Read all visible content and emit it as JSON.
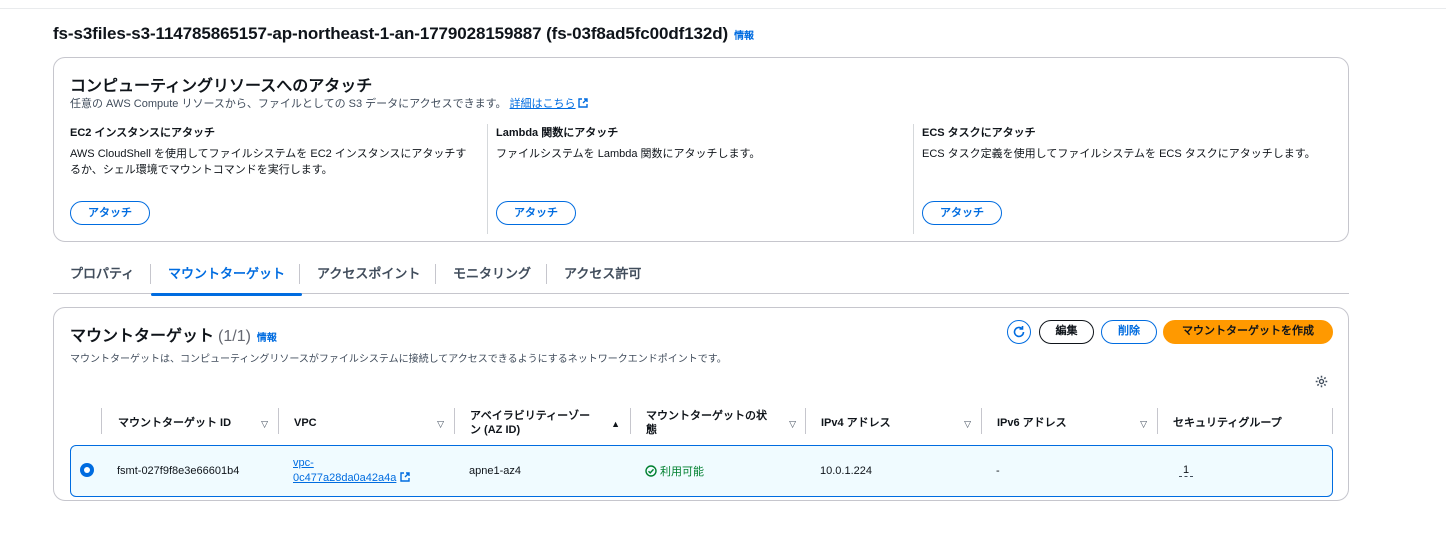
{
  "page": {
    "title": "fs-s3files-s3-114785865157-ap-northeast-1-an-1779028159887 (fs-03f8ad5fc00df132d)",
    "info_label": "情報"
  },
  "attach": {
    "heading": "コンピューティングリソースへのアタッチ",
    "description": "任意の AWS Compute リソースから、ファイルとしての S3 データにアクセスできます。",
    "learn_more": "詳細はこちら",
    "columns": [
      {
        "title": "EC2 インスタンスにアタッチ",
        "text": "AWS CloudShell を使用してファイルシステムを EC2 インスタンスにアタッチするか、シェル環境でマウントコマンドを実行します。",
        "button": "アタッチ"
      },
      {
        "title": "Lambda 関数にアタッチ",
        "text": "ファイルシステムを Lambda 関数にアタッチします。",
        "button": "アタッチ"
      },
      {
        "title": "ECS タスクにアタッチ",
        "text": "ECS タスク定義を使用してファイルシステムを ECS タスクにアタッチします。",
        "button": "アタッチ"
      }
    ]
  },
  "tabs": [
    {
      "label": "プロパティ"
    },
    {
      "label": "マウントターゲット",
      "active": true
    },
    {
      "label": "アクセスポイント"
    },
    {
      "label": "モニタリング"
    },
    {
      "label": "アクセス許可"
    }
  ],
  "mount_targets": {
    "title": "マウントターゲット",
    "count": "(1/1)",
    "info_label": "情報",
    "description": "マウントターゲットは、コンピューティングリソースがファイルシステムに接続してアクセスできるようにするネットワークエンドポイントです。",
    "buttons": {
      "edit": "編集",
      "delete": "削除",
      "create": "マウントターゲットを作成"
    },
    "columns": [
      "マウントターゲット ID",
      "VPC",
      "アベイラビリティーゾーン (AZ ID)",
      "マウントターゲットの状態",
      "IPv4 アドレス",
      "IPv6 アドレス",
      "セキュリティグループ"
    ],
    "rows": [
      {
        "id": "fsmt-027f9f8e3e66601b4",
        "vpc_line1": "vpc-",
        "vpc_line2": "0c477a28da0a42a4a",
        "az": "apne1-az4",
        "status": "利用可能",
        "ipv4": "10.0.1.224",
        "ipv6": "-",
        "security_groups": "1"
      }
    ]
  },
  "colors": {
    "accent": "#006ce0",
    "primary_button": "#ff9900",
    "success": "#00802f",
    "selected_row_bg": "#f0fbff"
  },
  "icons": [
    "external-link-icon",
    "refresh-icon",
    "settings-gear-icon",
    "sort-icon",
    "check-circle-icon"
  ]
}
